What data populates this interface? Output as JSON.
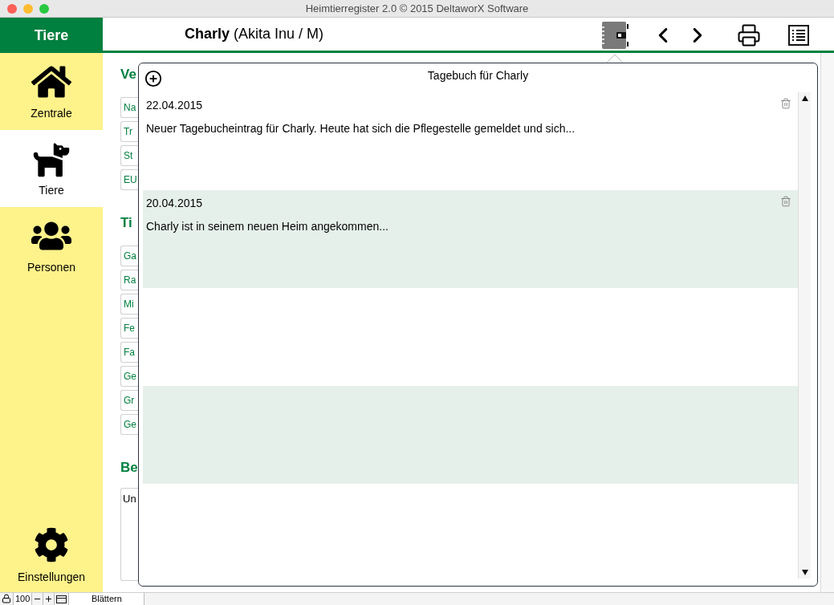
{
  "window": {
    "title": "Heimtierregister 2.0 © 2015 DeltaworX Software"
  },
  "sidebar": {
    "header": "Tiere",
    "items": [
      {
        "label": "Zentrale",
        "kind": "house",
        "selected": false
      },
      {
        "label": "Tiere",
        "kind": "dog",
        "selected": true
      },
      {
        "label": "Personen",
        "kind": "people",
        "selected": false
      }
    ],
    "footer_item": {
      "label": "Einstellungen",
      "kind": "gear"
    }
  },
  "header": {
    "name": "Charly",
    "details": "(Akita Inu / M)"
  },
  "background": {
    "sections": [
      {
        "title": "Ve",
        "fields": [
          "Na",
          "Tr",
          "St",
          "EU"
        ]
      },
      {
        "title": "Ti",
        "fields": [
          "Ga",
          "Ra",
          "Mi",
          "Fe",
          "Fa",
          "Ge",
          "Gr",
          "Ge"
        ]
      },
      {
        "title": "Be",
        "notes": "Un"
      }
    ]
  },
  "popover": {
    "title": "Tagebuch für Charly",
    "entries": [
      {
        "date": "22.04.2015",
        "text": "Neuer Tagebucheintrag für Charly. Heute hat sich die Pflegestelle gemeldet und sich..."
      },
      {
        "date": "20.04.2015",
        "text": "Charly ist in seinem neuen Heim angekommen..."
      }
    ]
  },
  "status_bar": {
    "zoom": "100",
    "mode": "Blättern"
  }
}
